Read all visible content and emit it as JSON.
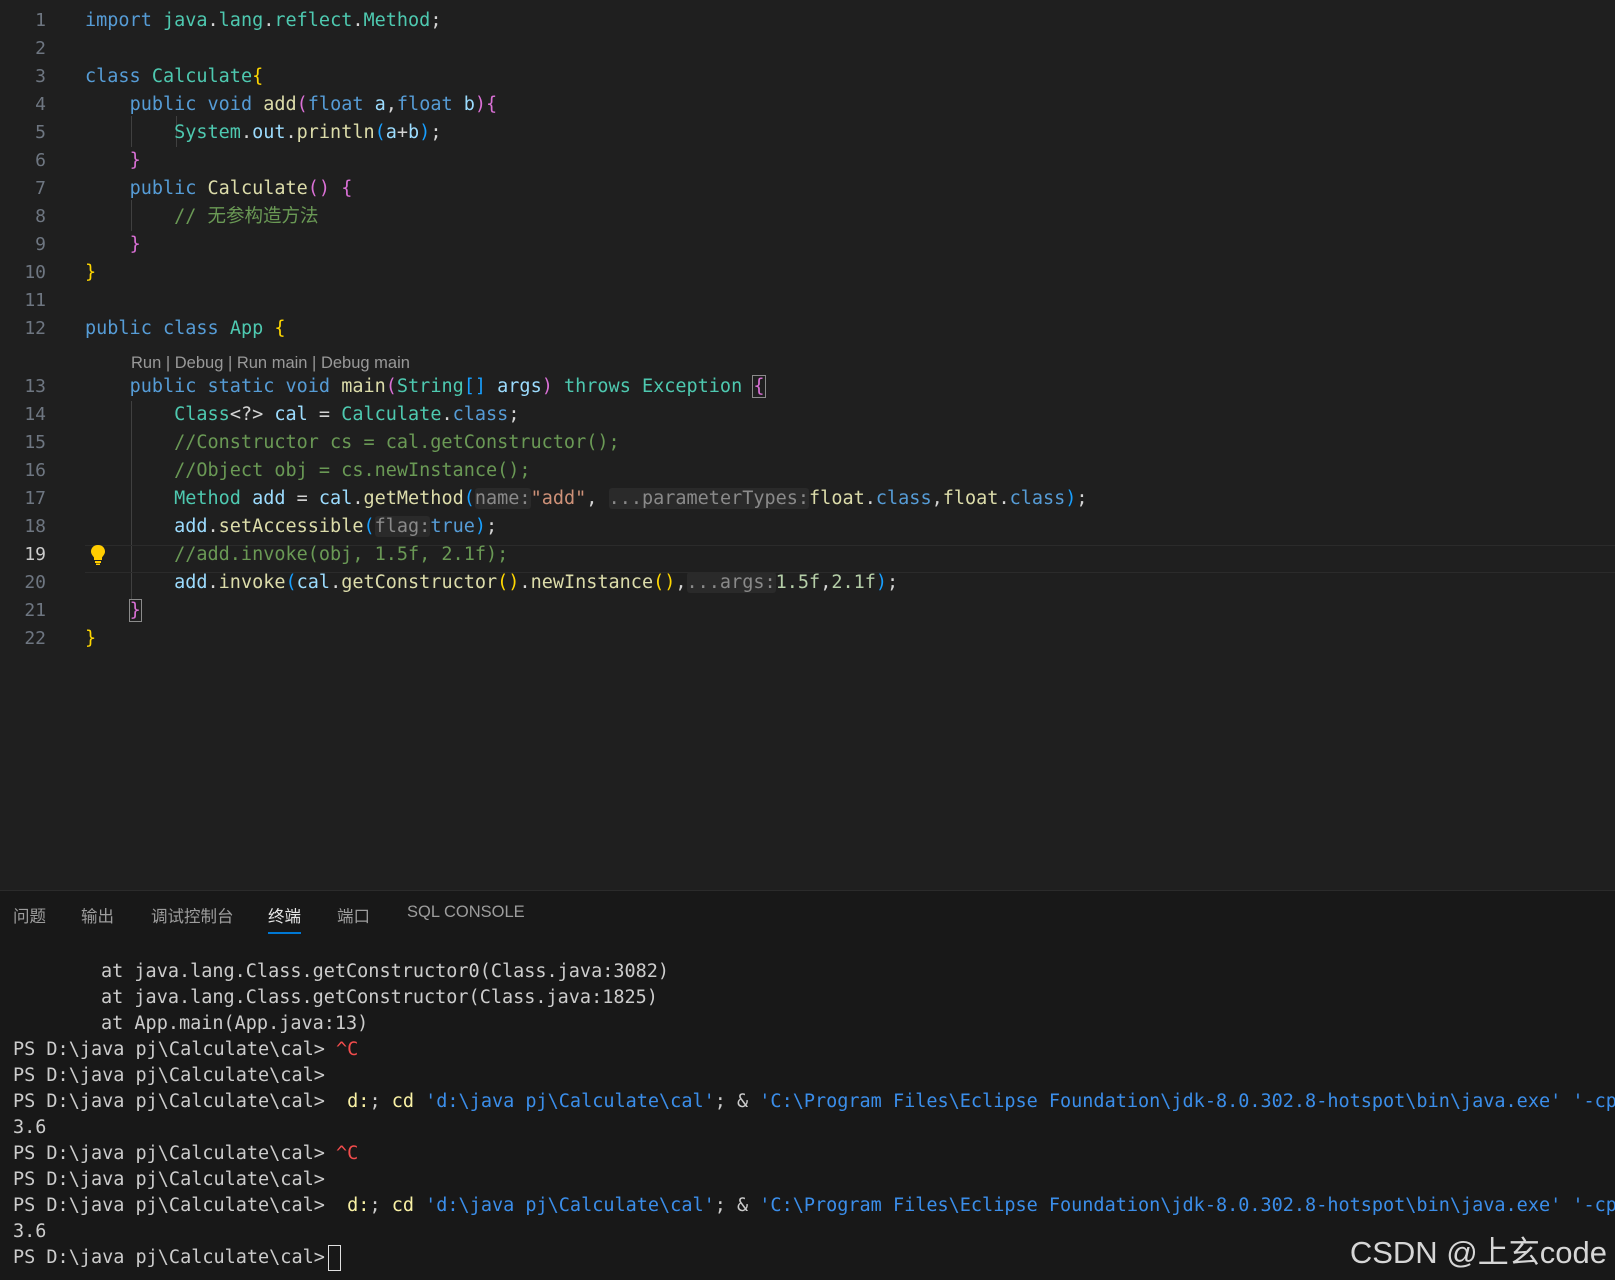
{
  "editor": {
    "line_numbers": [
      "1",
      "2",
      "3",
      "4",
      "5",
      "6",
      "7",
      "8",
      "9",
      "10",
      "11",
      "12",
      "13",
      "14",
      "15",
      "16",
      "17",
      "18",
      "19",
      "20",
      "21",
      "22"
    ],
    "line1": {
      "kw": "import",
      "pkg": "java",
      "d1": ".",
      "p2": "lang",
      "d2": ".",
      "p3": "reflect",
      "d3": ".",
      "cls": "Method",
      "semi": ";"
    },
    "line3": {
      "kw": "class",
      "name": "Calculate",
      "brace": "{"
    },
    "line4": {
      "kw1": "public",
      "kw2": "void",
      "fn": "add",
      "lp": "(",
      "t1": "float",
      "a": "a",
      "comma": ",",
      "t2": "float",
      "b": "b",
      "rp": ")",
      "brace": "{"
    },
    "line5": {
      "sys": "System",
      "d1": ".",
      "out": "out",
      "d2": ".",
      "fn": "println",
      "lp": "(",
      "a": "a",
      "plus": "+",
      "b": "b",
      "rp": ")",
      "semi": ";"
    },
    "line6": {
      "brace": "}"
    },
    "line7": {
      "kw": "public",
      "fn": "Calculate",
      "parens": "()",
      "brace": "{"
    },
    "line8": {
      "comment": "// 无参构造方法"
    },
    "line9": {
      "brace": "}"
    },
    "line10": {
      "brace": "}"
    },
    "line12": {
      "kw1": "public",
      "kw2": "class",
      "name": "App",
      "brace": "{"
    },
    "codelens": {
      "run": "Run",
      "sep1": " | ",
      "debug": "Debug",
      "sep2": " | ",
      "run_main": "Run main",
      "sep3": " | ",
      "debug_main": "Debug main"
    },
    "line13": {
      "kw1": "public",
      "kw2": "static",
      "kw3": "void",
      "fn": "main",
      "lp": "(",
      "type": "String",
      "arr": "[]",
      "args": "args",
      "rp": ")",
      "throws": "throws",
      "exc": "Exception",
      "brace": "{"
    },
    "line14": {
      "cls": "Class",
      "gen": "<?>",
      "var": "cal",
      "eq": " = ",
      "type": "Calculate",
      "dot": ".",
      "kwclass": "class",
      "semi": ";"
    },
    "line15": {
      "comment": "//Constructor cs = cal.getConstructor();"
    },
    "line16": {
      "comment": "//Object obj = cs.newInstance();"
    },
    "line17": {
      "type": "Method",
      "var": "add",
      "eq": " = ",
      "cal": "cal",
      "dot": ".",
      "fn": "getMethod",
      "lp": "(",
      "hint1": "name:",
      "str": "\"add\"",
      "comma": ", ",
      "hint2": "...parameterTypes:",
      "f1": "float",
      "d1": ".",
      "c1": "class",
      "comma2": ",",
      "f2": "float",
      "d2": ".",
      "c2": "class",
      "rp": ")",
      "semi": ";"
    },
    "line18": {
      "var": "add",
      "dot": ".",
      "fn": "setAccessible",
      "lp": "(",
      "hint": "flag:",
      "val": "true",
      "rp": ")",
      "semi": ";"
    },
    "line19": {
      "comment": "//add.invoke(obj, 1.5f, 2.1f);"
    },
    "line20": {
      "var": "add",
      "dot1": ".",
      "fn1": "invoke",
      "lp1": "(",
      "cal": "cal",
      "dot2": ".",
      "fn2": "getConstructor",
      "pp1": "()",
      "dot3": ".",
      "fn3": "newInstance",
      "pp2": "()",
      "comma": ",",
      "hint": "...args:",
      "n1": "1.5f",
      "comma2": ",",
      "n2": "2.1f",
      "rp1": ")",
      "semi": ";"
    },
    "line21": {
      "brace": "}"
    },
    "line22": {
      "brace": "}"
    }
  },
  "panel": {
    "tabs": [
      "问题",
      "输出",
      "调试控制台",
      "终端",
      "端口",
      "SQL CONSOLE"
    ],
    "active_tab": "终端"
  },
  "terminal": {
    "stack": [
      "at java.lang.Class.getConstructor0(Class.java:3082)",
      "at java.lang.Class.getConstructor(Class.java:1825)",
      "at App.main(App.java:13)"
    ],
    "prompt": "PS D:\\java pj\\Calculate\\cal>",
    "ctrl_c": "^C",
    "cmd_d": "d:",
    "cmd_semi1": "; ",
    "cmd_cd": "cd",
    "cmd_path": "'d:\\java pj\\Calculate\\cal'",
    "cmd_semi2": "; & ",
    "cmd_exe": "'C:\\Program Files\\Eclipse Foundation\\jdk-8.0.302.8-hotspot\\bin\\java.exe'",
    "cmd_cp": "'-cp'",
    "output": "3.6"
  },
  "watermark": "CSDN @上玄code",
  "colors": {
    "editor_bg": "#1f1f1f",
    "panel_bg": "#181818",
    "keyword": "#569cd6",
    "type": "#4ec9b0",
    "function": "#dcdcaa",
    "variable": "#9cdcfe",
    "string": "#ce9178",
    "comment": "#6a9955",
    "tab_underline": "#0078d4"
  }
}
